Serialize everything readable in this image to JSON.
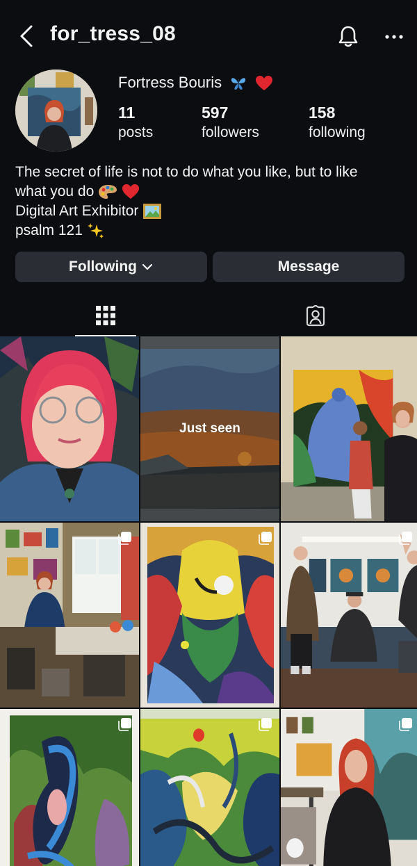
{
  "header": {
    "username": "for_tress_08",
    "back_icon": "chevron-left-icon",
    "notifications_icon": "bell-icon",
    "more_icon": "more-horizontal-icon"
  },
  "profile": {
    "display_name": "Fortress Bouris",
    "name_emojis": [
      "butterfly",
      "red-heart"
    ],
    "stats": [
      {
        "value": "11",
        "label": "posts"
      },
      {
        "value": "597",
        "label": "followers"
      },
      {
        "value": "158",
        "label": "following"
      }
    ],
    "bio": {
      "line1": "The secret of life is not to do what you like, but to like",
      "line2": "what you do",
      "line3": "Digital Art Exhibitor",
      "line4": "psalm 121"
    }
  },
  "actions": {
    "following_label": "Following",
    "message_label": "Message"
  },
  "tabs": {
    "active": "posts-grid",
    "items": [
      "grid-icon",
      "tagged-icon"
    ]
  },
  "posts": {
    "overlay_text": "Just seen",
    "items": [
      {
        "subject": "selfie portrait, pink hair",
        "multi": false
      },
      {
        "subject": "sunset landscape painting",
        "multi": false,
        "overlay": true
      },
      {
        "subject": "painting with woman and child",
        "multi": false
      },
      {
        "subject": "artist in studio",
        "multi": true
      },
      {
        "subject": "abstract colorful painting",
        "multi": true
      },
      {
        "subject": "gallery group photo",
        "multi": true
      },
      {
        "subject": "blue figure painting",
        "multi": true
      },
      {
        "subject": "green swirl painting",
        "multi": true
      },
      {
        "subject": "artist with red hair in studio",
        "multi": true
      }
    ]
  },
  "colors": {
    "background": "#0b0d10",
    "button": "#2a2e34",
    "text": "#f3f3f3",
    "heart": "#e0262f",
    "butterfly": "#5aa8e6"
  }
}
